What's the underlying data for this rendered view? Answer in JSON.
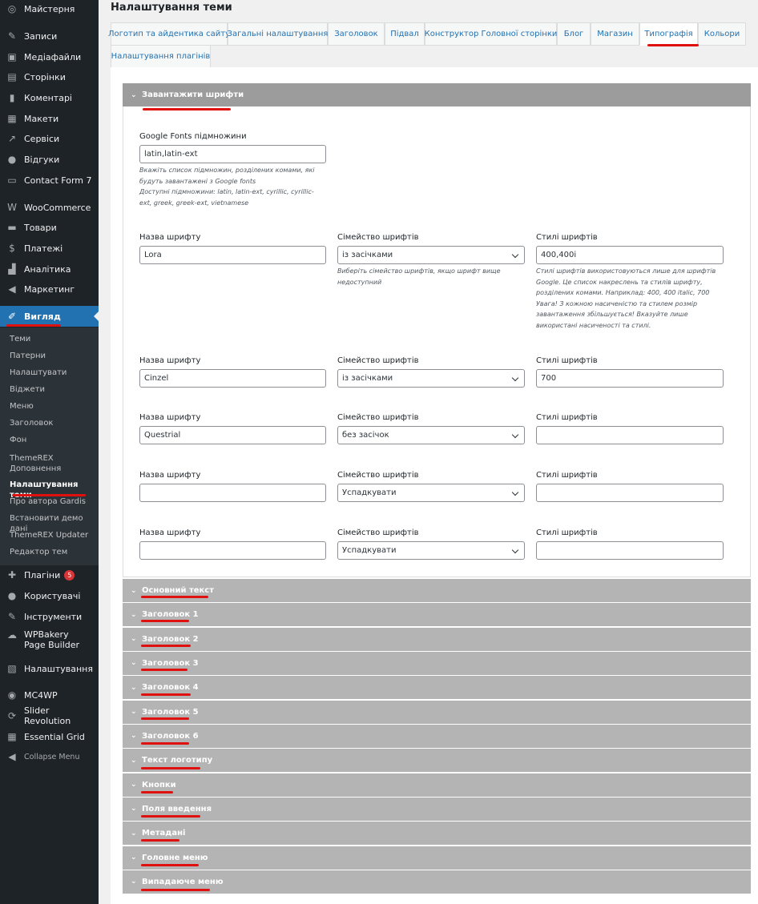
{
  "sidebar": {
    "items": [
      {
        "icon": "dashboard-icon",
        "glyph": "◎",
        "label": "Майстерня"
      },
      {
        "icon": "pin-icon",
        "glyph": "✎",
        "label": "Записи"
      },
      {
        "icon": "media-icon",
        "glyph": "▣",
        "label": "Медіафайли"
      },
      {
        "icon": "pages-icon",
        "glyph": "▤",
        "label": "Сторінки"
      },
      {
        "icon": "comments-icon",
        "glyph": "▮",
        "label": "Коментарі"
      },
      {
        "icon": "layouts-icon",
        "glyph": "▦",
        "label": "Макети"
      },
      {
        "icon": "wrench-icon",
        "glyph": "↗",
        "label": "Сервіси"
      },
      {
        "icon": "feedback-icon",
        "glyph": "●",
        "label": "Відгуки"
      },
      {
        "icon": "form-icon",
        "glyph": "▭",
        "label": "Contact Form 7"
      },
      {
        "icon": "woocommerce-icon",
        "glyph": "W",
        "label": "WooCommerce"
      },
      {
        "icon": "products-icon",
        "glyph": "▬",
        "label": "Товари"
      },
      {
        "icon": "payments-icon",
        "glyph": "$",
        "label": "Платежі"
      },
      {
        "icon": "analytics-icon",
        "glyph": "▟",
        "label": "Аналітика"
      },
      {
        "icon": "marketing-icon",
        "glyph": "◀",
        "label": "Маркетинг"
      },
      {
        "icon": "brush-icon",
        "glyph": "✐",
        "label": "Вигляд"
      },
      {
        "icon": "plugins-icon",
        "glyph": "✚",
        "label": "Плагіни",
        "badge": "5"
      },
      {
        "icon": "users-icon",
        "glyph": "●",
        "label": "Користувачі"
      },
      {
        "icon": "tools-icon",
        "glyph": "✎",
        "label": "Інструменти"
      },
      {
        "icon": "wpbakery-icon",
        "glyph": "☁",
        "label": "WPBakery Page Builder"
      },
      {
        "icon": "settings-icon",
        "glyph": "▧",
        "label": "Налаштування"
      },
      {
        "icon": "mc4wp-icon",
        "glyph": "◉",
        "label": "MC4WP"
      },
      {
        "icon": "slider-revolution-icon",
        "glyph": "⟳",
        "label": "Slider Revolution"
      },
      {
        "icon": "grid-icon",
        "glyph": "▦",
        "label": "Essential Grid"
      },
      {
        "icon": "collapse-icon",
        "glyph": "◀",
        "label": "Collapse Menu"
      }
    ],
    "submenu": [
      "Теми",
      "Патерни",
      "Налаштувати",
      "Віджети",
      "Меню",
      "Заголовок",
      "Фон",
      "ThemeREX Доповнення",
      "Налаштування теми",
      "Про автора Gardis",
      "Встановити демо дані",
      "ThemeREX Updater",
      "Редактор тем"
    ]
  },
  "page_title": "Налаштування теми",
  "tabs": [
    "Логотип та айдентика сайту",
    "Загальні налаштування",
    "Заголовок",
    "Підвал",
    "Конструктор Головної сторінки",
    "Блог",
    "Магазин",
    "Типографія",
    "Кольори",
    "Налаштування плагінів"
  ],
  "open_section": {
    "title": "Завантажити шрифти",
    "subsets": {
      "label": "Google Fonts підмножини",
      "value": "latin,latin-ext",
      "hint": "Вкажіть список підмножин, розділених комами, які будуть завантажені з Google fonts\nДоступні підмножини: latin, latin-ext, cyrillic, cyrillic-ext, greek, greek-ext, vietnamese"
    },
    "labels": {
      "name": "Назва шрифту",
      "family": "Сімейство шрифтів",
      "styles": "Стилі шрифтів"
    },
    "family_hint": "Виберіть сімейство шрифтів, якщо шрифт вище недоступний",
    "styles_hint": "Стилі шрифтів використовуються лише для шрифтів Google. Це список накреслень та стилів шрифту, розділених комами. Наприклад: 400, 400 italic, 700\nУвага! З кожною насиченістю та стилем розмір завантаження збільшується! Вказуйте лише використані насиченості та стилі.",
    "fonts": [
      {
        "name": "Lora",
        "family": "із засічками",
        "styles": "400,400i"
      },
      {
        "name": "Cinzel",
        "family": "із засічками",
        "styles": "700"
      },
      {
        "name": "Questrial",
        "family": "без засічок",
        "styles": ""
      },
      {
        "name": "",
        "family": "Успадкувати",
        "styles": ""
      },
      {
        "name": "",
        "family": "Успадкувати",
        "styles": ""
      }
    ]
  },
  "sections": [
    "Основний текст",
    "Заголовок 1",
    "Заголовок 2",
    "Заголовок 3",
    "Заголовок 4",
    "Заголовок 5",
    "Заголовок 6",
    "Текст логотипу",
    "Кнопки",
    "Поля введення",
    "Метадані",
    "Головне меню",
    "Випадаюче меню"
  ],
  "colors": {
    "sidebar": "#1d2327",
    "active": "#2271b1",
    "section_header": "#b4b4b4",
    "annotation": "#e0100f"
  }
}
